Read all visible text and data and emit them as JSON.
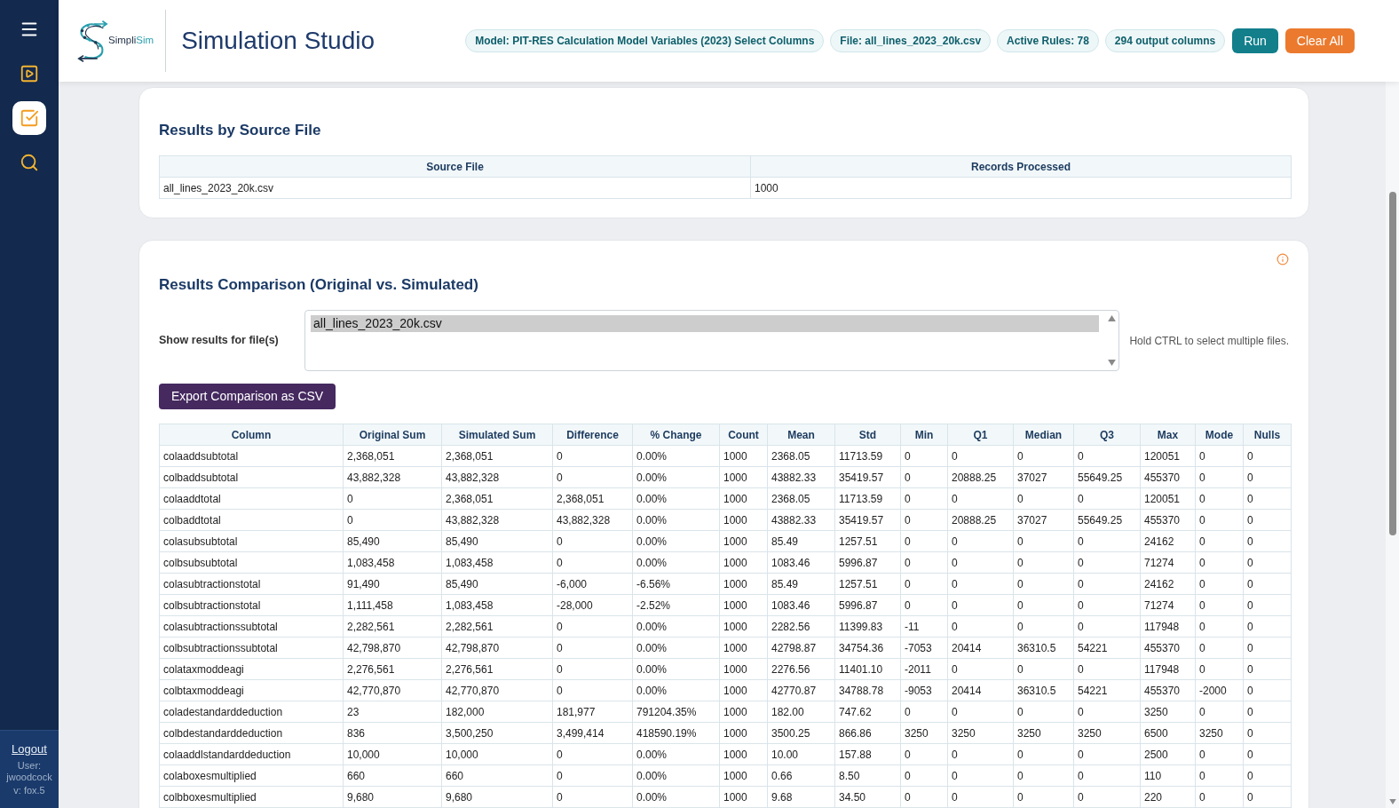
{
  "sidebar": {
    "nav": [
      {
        "selected": false
      },
      {
        "selected": true
      },
      {
        "selected": false
      }
    ],
    "footer": {
      "logout": "Logout",
      "user": "User: jwoodcock",
      "version": "v: fox.5"
    }
  },
  "header": {
    "logo_text": [
      "Simpli",
      "Sim"
    ],
    "title": "Simulation Studio",
    "badges": [
      "Model: PIT-RES Calculation Model Variables (2023) Select Columns",
      "File: all_lines_2023_20k.csv",
      "Active Rules: 78",
      "294 output columns"
    ],
    "buttons": [
      {
        "label": "Run",
        "kind": "primary"
      },
      {
        "label": "Clear All",
        "kind": "danger"
      }
    ]
  },
  "source_results": {
    "title": "Results by Source File",
    "columns": [
      "Source File",
      "Records Processed"
    ],
    "rows": [
      [
        "all_lines_2023_20k.csv",
        "1000"
      ]
    ]
  },
  "comparison": {
    "title": "Results Comparison (Original vs. Simulated)",
    "file_select": {
      "label": "Show results for file(s)",
      "options": [
        {
          "label": "all_lines_2023_20k.csv",
          "selected": true
        }
      ],
      "hint": "Hold CTRL to select multiple files."
    },
    "export_button": "Export Comparison as CSV",
    "table": {
      "columns": [
        "Column",
        "Original Sum",
        "Simulated Sum",
        "Difference",
        "% Change",
        "Count",
        "Mean",
        "Std",
        "Min",
        "Q1",
        "Median",
        "Q3",
        "Max",
        "Mode",
        "Nulls"
      ],
      "rows": [
        [
          "colaaddsubtotal",
          "2,368,051",
          "2,368,051",
          "0",
          "0.00%",
          "1000",
          "2368.05",
          "11713.59",
          "0",
          "0",
          "0",
          "0",
          "120051",
          "0",
          "0"
        ],
        [
          "colbaddsubtotal",
          "43,882,328",
          "43,882,328",
          "0",
          "0.00%",
          "1000",
          "43882.33",
          "35419.57",
          "0",
          "20888.25",
          "37027",
          "55649.25",
          "455370",
          "0",
          "0"
        ],
        [
          "colaaddtotal",
          "0",
          "2,368,051",
          "2,368,051",
          "0.00%",
          "1000",
          "2368.05",
          "11713.59",
          "0",
          "0",
          "0",
          "0",
          "120051",
          "0",
          "0"
        ],
        [
          "colbaddtotal",
          "0",
          "43,882,328",
          "43,882,328",
          "0.00%",
          "1000",
          "43882.33",
          "35419.57",
          "0",
          "20888.25",
          "37027",
          "55649.25",
          "455370",
          "0",
          "0"
        ],
        [
          "colasubsubtotal",
          "85,490",
          "85,490",
          "0",
          "0.00%",
          "1000",
          "85.49",
          "1257.51",
          "0",
          "0",
          "0",
          "0",
          "24162",
          "0",
          "0"
        ],
        [
          "colbsubsubtotal",
          "1,083,458",
          "1,083,458",
          "0",
          "0.00%",
          "1000",
          "1083.46",
          "5996.87",
          "0",
          "0",
          "0",
          "0",
          "71274",
          "0",
          "0"
        ],
        [
          "colasubtractionstotal",
          "91,490",
          "85,490",
          "-6,000",
          "-6.56%",
          "1000",
          "85.49",
          "1257.51",
          "0",
          "0",
          "0",
          "0",
          "24162",
          "0",
          "0"
        ],
        [
          "colbsubtractionstotal",
          "1,111,458",
          "1,083,458",
          "-28,000",
          "-2.52%",
          "1000",
          "1083.46",
          "5996.87",
          "0",
          "0",
          "0",
          "0",
          "71274",
          "0",
          "0"
        ],
        [
          "colasubtractionssubtotal",
          "2,282,561",
          "2,282,561",
          "0",
          "0.00%",
          "1000",
          "2282.56",
          "11399.83",
          "-11",
          "0",
          "0",
          "0",
          "117948",
          "0",
          "0"
        ],
        [
          "colbsubtractionssubtotal",
          "42,798,870",
          "42,798,870",
          "0",
          "0.00%",
          "1000",
          "42798.87",
          "34754.36",
          "-7053",
          "20414",
          "36310.5",
          "54221",
          "455370",
          "0",
          "0"
        ],
        [
          "colataxmoddeagi",
          "2,276,561",
          "2,276,561",
          "0",
          "0.00%",
          "1000",
          "2276.56",
          "11401.10",
          "-2011",
          "0",
          "0",
          "0",
          "117948",
          "0",
          "0"
        ],
        [
          "colbtaxmoddeagi",
          "42,770,870",
          "42,770,870",
          "0",
          "0.00%",
          "1000",
          "42770.87",
          "34788.78",
          "-9053",
          "20414",
          "36310.5",
          "54221",
          "455370",
          "-2000",
          "0"
        ],
        [
          "coladestandarddeduction",
          "23",
          "182,000",
          "181,977",
          "791204.35%",
          "1000",
          "182.00",
          "747.62",
          "0",
          "0",
          "0",
          "0",
          "3250",
          "0",
          "0"
        ],
        [
          "colbdestandarddeduction",
          "836",
          "3,500,250",
          "3,499,414",
          "418590.19%",
          "1000",
          "3500.25",
          "866.86",
          "3250",
          "3250",
          "3250",
          "3250",
          "6500",
          "3250",
          "0"
        ],
        [
          "colaaddlstandarddeduction",
          "10,000",
          "10,000",
          "0",
          "0.00%",
          "1000",
          "10.00",
          "157.88",
          "0",
          "0",
          "0",
          "0",
          "2500",
          "0",
          "0"
        ],
        [
          "colaboxesmultiplied",
          "660",
          "660",
          "0",
          "0.00%",
          "1000",
          "0.66",
          "8.50",
          "0",
          "0",
          "0",
          "0",
          "110",
          "0",
          "0"
        ],
        [
          "colbboxesmultiplied",
          "9,680",
          "9,680",
          "0",
          "0.00%",
          "1000",
          "9.68",
          "34.50",
          "0",
          "0",
          "0",
          "0",
          "220",
          "0",
          "0"
        ]
      ]
    }
  }
}
